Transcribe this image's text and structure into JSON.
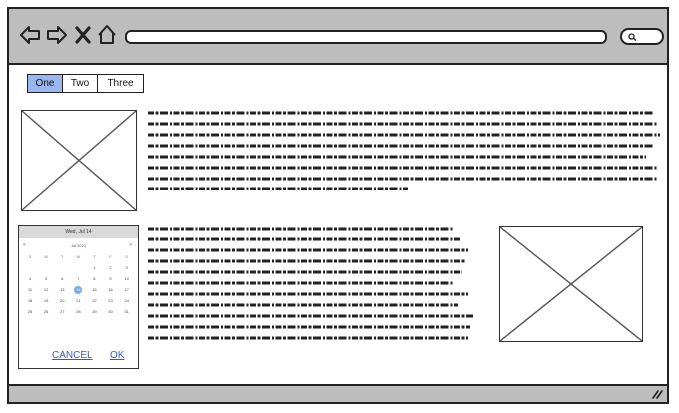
{
  "tabs": [
    {
      "label": "One",
      "active": true
    },
    {
      "label": "Two",
      "active": false
    },
    {
      "label": "Three",
      "active": false
    }
  ],
  "datepicker": {
    "header": "Wed, Jul 14",
    "month_label": "Jul 2021",
    "prev_icon": "<",
    "next_icon": ">",
    "weekdays": [
      "S",
      "M",
      "T",
      "W",
      "T",
      "F",
      "S"
    ],
    "weeks": [
      [
        "",
        "",
        "",
        "",
        "1",
        "2",
        "3"
      ],
      [
        "4",
        "5",
        "6",
        "7",
        "8",
        "9",
        "10"
      ],
      [
        "11",
        "12",
        "13",
        "14",
        "15",
        "16",
        "17"
      ],
      [
        "18",
        "19",
        "20",
        "21",
        "22",
        "23",
        "24"
      ],
      [
        "25",
        "26",
        "27",
        "28",
        "29",
        "30",
        "31"
      ]
    ],
    "selected": "14",
    "cancel_label": "CANCEL",
    "ok_label": "OK"
  },
  "colors": {
    "active_tab": "#9ab6ee",
    "selected_day": "#7aa6e8",
    "chrome": "#bdbdbd"
  }
}
